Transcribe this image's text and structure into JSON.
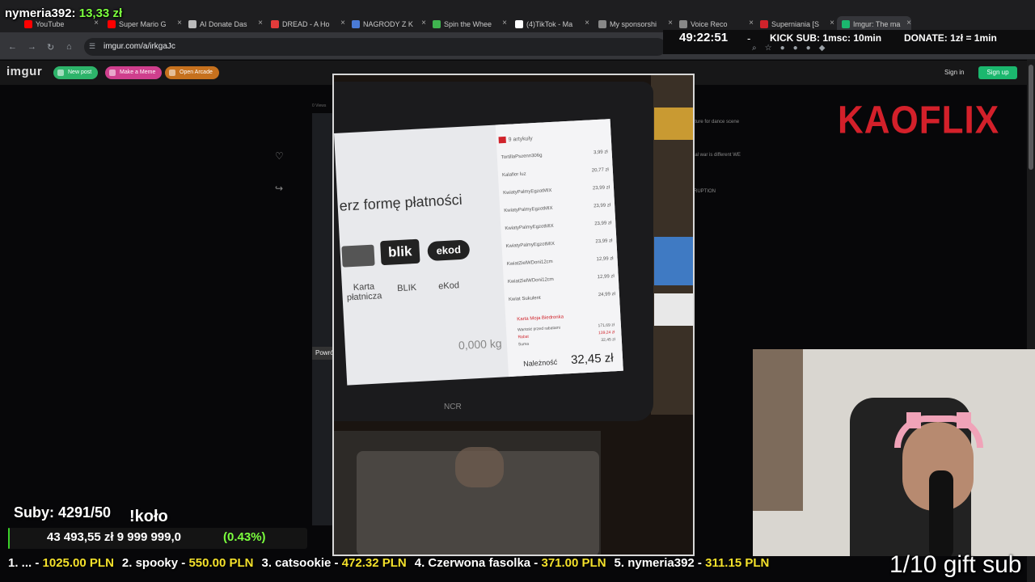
{
  "browser": {
    "tabs": [
      {
        "label": "YouTube",
        "color": "#ff0000"
      },
      {
        "label": "Super Mario G",
        "color": "#ff0000"
      },
      {
        "label": "AI Donate Das",
        "color": "#bbbbbb"
      },
      {
        "label": "DREAD - A Ho",
        "color": "#e23b3b"
      },
      {
        "label": "NAGRODY Z K",
        "color": "#4a7bd6"
      },
      {
        "label": "Spin the Whee",
        "color": "#3fb34f"
      },
      {
        "label": "(4)TikTok - Ma",
        "color": "#ffffff"
      },
      {
        "label": "My sponsorshi",
        "color": "#888888"
      },
      {
        "label": "Voice Reco",
        "color": "#888888"
      },
      {
        "label": "Superniania [S",
        "color": "#d0232b"
      },
      {
        "label": "Imgur: The ma",
        "color": "#1bb76e"
      }
    ],
    "url": "imgur.com/a/irkgaJc"
  },
  "overlay": {
    "donor_name": "nymeria392:",
    "donor_amount": "13,33 zł",
    "timer": "49:22:51",
    "timer_sep": "-",
    "kick_sub": "KICK SUB: 1msc: 10min",
    "donate_rate": "DONATE: 1zł = 1min",
    "kaoflix": "KAOFLIX",
    "subs": "Suby: 4291/50",
    "kolo": "!koło",
    "goal_current": "43 493,55 zł",
    "goal_target": "9 999 999,0",
    "goal_percent": "(0.43%)",
    "goal_fraction": 0.0043,
    "gift": "1/10 gift sub",
    "leaderboard": [
      {
        "rank": "1. ... -",
        "value": "1025.00 PLN"
      },
      {
        "rank": "2. spooky -",
        "value": "550.00 PLN"
      },
      {
        "rank": "3. catsookie -",
        "value": "472.32 PLN"
      },
      {
        "rank": "4. Czerwona fasolka -",
        "value": "371.00 PLN"
      },
      {
        "rank": "5. nymeria392 -",
        "value": "311.15 PLN"
      }
    ]
  },
  "imgur": {
    "logo": "imgur",
    "new_post": "New post",
    "make_meme": "Make a Meme",
    "open_arcade": "Open Arcade",
    "sign_in": "Sign in",
    "sign_up": "Sign up",
    "views": "0 Views",
    "side_snippets": [
      "iture for dance scene",
      "ial war is different WE",
      "RUPTION"
    ]
  },
  "kiosk": {
    "title": "erz formę płatności",
    "options": [
      "Karta płatnicza",
      "BLIK",
      "eKod"
    ],
    "blik_logo": "blik",
    "ekod_logo": "ekod",
    "cart_count": "9 artykuły",
    "items": [
      {
        "name": "TortillaPszenn306g",
        "price": "3,99 zł"
      },
      {
        "name": "Kalafior luz",
        "price": "20,77 zł"
      },
      {
        "name": "KwiatyPalmyEgzotMIX",
        "price": "23,99 zł"
      },
      {
        "name": "KwiatyPalmyEgzotMIX",
        "price": "23,99 zł"
      },
      {
        "name": "KwiatyPalmyEgzotMIX",
        "price": "23,99 zł"
      },
      {
        "name": "KwiatyPalmyEgzotMIX",
        "price": "23,99 zł"
      },
      {
        "name": "KwiatZielWDoni12cm",
        "price": "12,99 zł"
      },
      {
        "name": "KwiatZielWDoni12cm",
        "price": "12,99 zł"
      },
      {
        "name": "Kwiat Sukulent",
        "price": "24,99 zł"
      }
    ],
    "card_note": "Karta Moja Biedronka",
    "before_discount_label": "Wartość przed rabatami",
    "before_discount": "171,69 zł",
    "discount_label": "Rabat",
    "discount": "139,24 zł",
    "sum_label": "Suma",
    "sum": "32,45 zł",
    "due_label": "Należność",
    "due": "32,45 zł",
    "weight": "0,000 kg",
    "back": "Powrót",
    "brand": "NCR"
  }
}
